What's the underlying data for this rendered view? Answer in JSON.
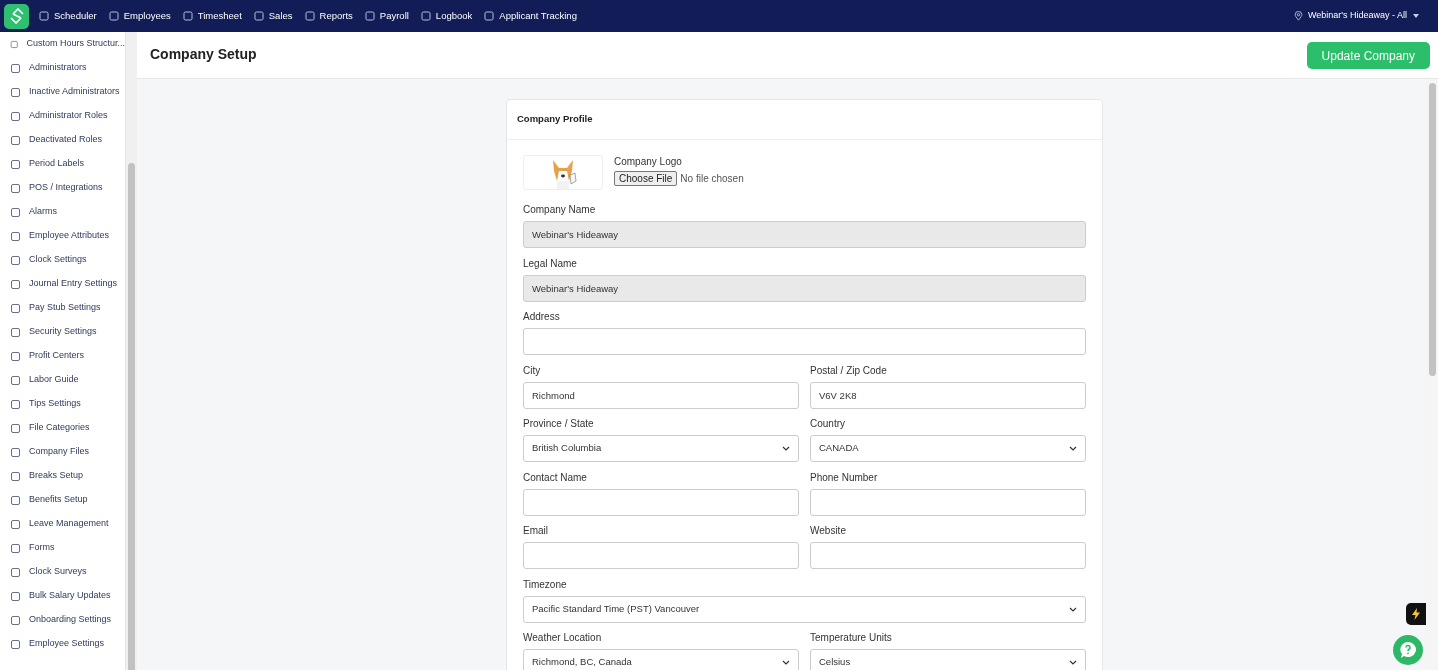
{
  "top_nav": {
    "items": [
      {
        "label": "Scheduler"
      },
      {
        "label": "Employees"
      },
      {
        "label": "Timesheet"
      },
      {
        "label": "Sales"
      },
      {
        "label": "Reports"
      },
      {
        "label": "Payroll"
      },
      {
        "label": "Logbook"
      },
      {
        "label": "Applicant Tracking"
      }
    ],
    "location": "Webinar's Hideaway - All"
  },
  "sidebar": {
    "items": [
      {
        "label": "Custom Hours Structur..."
      },
      {
        "label": "Administrators"
      },
      {
        "label": "Inactive Administrators"
      },
      {
        "label": "Administrator Roles"
      },
      {
        "label": "Deactivated Roles"
      },
      {
        "label": "Period Labels"
      },
      {
        "label": "POS / Integrations"
      },
      {
        "label": "Alarms"
      },
      {
        "label": "Employee Attributes"
      },
      {
        "label": "Clock Settings"
      },
      {
        "label": "Journal Entry Settings"
      },
      {
        "label": "Pay Stub Settings"
      },
      {
        "label": "Security Settings"
      },
      {
        "label": "Profit Centers"
      },
      {
        "label": "Labor Guide"
      },
      {
        "label": "Tips Settings"
      },
      {
        "label": "File Categories"
      },
      {
        "label": "Company Files"
      },
      {
        "label": "Breaks Setup"
      },
      {
        "label": "Benefits Setup"
      },
      {
        "label": "Leave Management"
      },
      {
        "label": "Forms"
      },
      {
        "label": "Clock Surveys"
      },
      {
        "label": "Bulk Salary Updates"
      },
      {
        "label": "Onboarding Settings"
      },
      {
        "label": "Employee Settings"
      }
    ]
  },
  "page": {
    "title": "Company Setup",
    "action_button": "Update Company"
  },
  "card": {
    "title": "Company Profile",
    "logo": {
      "label": "Company Logo",
      "button": "Choose File",
      "status": "No file chosen"
    },
    "rows": [
      {
        "fields": [
          {
            "label": "Company Name",
            "kind": "text",
            "value": "Webinar's Hideaway",
            "disabled": true
          }
        ]
      },
      {
        "fields": [
          {
            "label": "Legal Name",
            "kind": "text",
            "value": "Webinar's Hideaway",
            "disabled": true
          }
        ]
      },
      {
        "fields": [
          {
            "label": "Address",
            "kind": "text",
            "disabled": false
          }
        ]
      },
      {
        "fields": [
          {
            "label": "City",
            "kind": "text",
            "value": "Richmond",
            "disabled": false
          },
          {
            "label": "Postal / Zip Code",
            "kind": "text",
            "value": "V6V 2K8",
            "disabled": false
          }
        ]
      },
      {
        "fields": [
          {
            "label": "Province / State",
            "kind": "select",
            "value": "British Columbia",
            "disabled": false
          },
          {
            "label": "Country",
            "kind": "select",
            "value": "CANADA",
            "disabled": false
          }
        ]
      },
      {
        "fields": [
          {
            "label": "Contact Name",
            "kind": "text",
            "disabled": false
          },
          {
            "label": "Phone Number",
            "kind": "text",
            "disabled": false
          }
        ]
      },
      {
        "fields": [
          {
            "label": "Email",
            "kind": "text",
            "disabled": false
          },
          {
            "label": "Website",
            "kind": "text",
            "disabled": false
          }
        ]
      },
      {
        "fields": [
          {
            "label": "Timezone",
            "kind": "select",
            "value": "Pacific Standard Time (PST) Vancouver",
            "disabled": false
          }
        ]
      },
      {
        "fields": [
          {
            "label": "Weather Location",
            "kind": "select",
            "value": "Richmond, BC, Canada",
            "disabled": false
          },
          {
            "label": "Temperature Units",
            "kind": "select",
            "value": "Celsius",
            "disabled": false
          }
        ]
      }
    ]
  }
}
